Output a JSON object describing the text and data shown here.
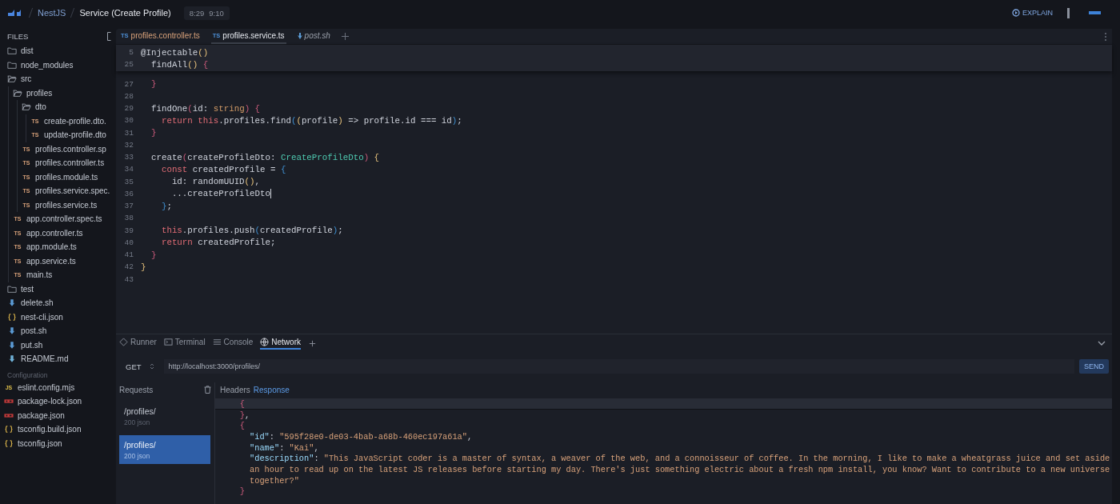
{
  "topbar": {
    "crumbs": [
      "NestJS",
      "Service (Create Profile)"
    ],
    "time": [
      "8:29",
      "9:10"
    ],
    "explain": "EXPLAIN"
  },
  "sidebar": {
    "title": "FILES",
    "files": [
      {
        "name": "dist",
        "kind": "folder",
        "expanded": false
      },
      {
        "name": "node_modules",
        "kind": "folder",
        "expanded": false
      },
      {
        "name": "src",
        "kind": "folder",
        "expanded": true,
        "children": [
          {
            "name": "profiles",
            "kind": "folder",
            "expanded": true,
            "children": [
              {
                "name": "dto",
                "kind": "folder",
                "expanded": true,
                "children": [
                  {
                    "name": "create-profile.dto.",
                    "kind": "ts",
                    "badge": "TS"
                  },
                  {
                    "name": "update-profile.dto",
                    "kind": "ts",
                    "badge": "TS"
                  }
                ]
              },
              {
                "name": "profiles.controller.sp",
                "kind": "ts",
                "badge": "TS"
              },
              {
                "name": "profiles.controller.ts",
                "kind": "ts",
                "badge": "TS"
              },
              {
                "name": "profiles.module.ts",
                "kind": "ts",
                "badge": "TS"
              },
              {
                "name": "profiles.service.spec.",
                "kind": "ts",
                "badge": "TS"
              },
              {
                "name": "profiles.service.ts",
                "kind": "ts",
                "badge": "TS"
              }
            ]
          },
          {
            "name": "app.controller.spec.ts",
            "kind": "ts",
            "badge": "TS"
          },
          {
            "name": "app.controller.ts",
            "kind": "ts",
            "badge": "TS"
          },
          {
            "name": "app.module.ts",
            "kind": "ts",
            "badge": "TS"
          },
          {
            "name": "app.service.ts",
            "kind": "ts",
            "badge": "TS"
          },
          {
            "name": "main.ts",
            "kind": "ts",
            "badge": "TS"
          }
        ]
      },
      {
        "name": "test",
        "kind": "folder",
        "expanded": false
      },
      {
        "name": "delete.sh",
        "kind": "sh"
      },
      {
        "name": "nest-cli.json",
        "kind": "json"
      },
      {
        "name": "post.sh",
        "kind": "sh"
      },
      {
        "name": "put.sh",
        "kind": "sh"
      },
      {
        "name": "README.md",
        "kind": "md"
      }
    ],
    "config_title": "Configuration",
    "config": [
      {
        "name": "eslint.config.mjs",
        "kind": "js",
        "badge": "JS"
      },
      {
        "name": "package-lock.json",
        "kind": "npm"
      },
      {
        "name": "package.json",
        "kind": "npm"
      },
      {
        "name": "tsconfig.build.json",
        "kind": "json"
      },
      {
        "name": "tsconfig.json",
        "kind": "json"
      }
    ]
  },
  "editor": {
    "tabs": [
      {
        "label": "profiles.controller.ts",
        "kind": "ts",
        "badge": "TS",
        "selected": false
      },
      {
        "label": "profiles.service.ts",
        "kind": "ts",
        "badge": "TS",
        "selected": true
      },
      {
        "label": "post.sh",
        "kind": "sh",
        "selected": false
      }
    ],
    "sticky": [
      {
        "number": "5",
        "tokens": [
          {
            "text": "@Injectable",
            "kind": "plain"
          },
          {
            "text": "()",
            "kind": "paren"
          }
        ]
      },
      {
        "number": "25",
        "tokens": [
          {
            "text": "  findAll",
            "kind": "plain"
          },
          {
            "text": "()",
            "kind": "paren"
          },
          {
            "text": " {",
            "kind": "brace"
          }
        ]
      }
    ],
    "lines": [
      {
        "number": "27",
        "cursor": false,
        "tokens": [
          {
            "text": "  }",
            "kind": "brace"
          }
        ]
      },
      {
        "number": "28",
        "cursor": false
      },
      {
        "number": "29",
        "cursor": false,
        "tokens": [
          {
            "text": "  findOne",
            "kind": "plain"
          },
          {
            "text": "(",
            "kind": "brace"
          },
          {
            "text": "id: ",
            "kind": "plain"
          },
          {
            "text": "string",
            "kind": "builtin"
          },
          {
            "text": ") {",
            "kind": "brace"
          }
        ]
      },
      {
        "number": "30",
        "cursor": false,
        "tokens": [
          {
            "text": "    return",
            "kind": "keyword"
          },
          {
            "text": " this",
            "kind": "keyword"
          },
          {
            "text": ".profiles.find",
            "kind": "plain"
          },
          {
            "text": "(",
            "kind": "block"
          },
          {
            "text": "(",
            "kind": "paren"
          },
          {
            "text": "profile",
            "kind": "plain"
          },
          {
            "text": ")",
            "kind": "paren"
          },
          {
            "text": " => profile.id === id",
            "kind": "plain"
          },
          {
            "text": ")",
            "kind": "block"
          },
          {
            "text": ";",
            "kind": "plain"
          }
        ]
      },
      {
        "number": "31",
        "cursor": false,
        "tokens": [
          {
            "text": "  }",
            "kind": "brace"
          }
        ]
      },
      {
        "number": "32",
        "cursor": false
      },
      {
        "number": "33",
        "cursor": false,
        "tokens": [
          {
            "text": "  create",
            "kind": "plain"
          },
          {
            "text": "(",
            "kind": "brace"
          },
          {
            "text": "createProfileDto: ",
            "kind": "plain"
          },
          {
            "text": "CreateProfileDto",
            "kind": "type"
          },
          {
            "text": ")",
            "kind": "brace"
          },
          {
            "text": " {",
            "kind": "paren"
          }
        ]
      },
      {
        "number": "34",
        "cursor": false,
        "tokens": [
          {
            "text": "    const",
            "kind": "keyword"
          },
          {
            "text": " createdProfile = ",
            "kind": "plain"
          },
          {
            "text": "{",
            "kind": "block"
          }
        ]
      },
      {
        "number": "35",
        "cursor": false,
        "tokens": [
          {
            "text": "      id: randomUUID",
            "kind": "plain"
          },
          {
            "text": "()",
            "kind": "paren"
          },
          {
            "text": ",",
            "kind": "plain"
          }
        ]
      },
      {
        "number": "36",
        "cursor": true,
        "tokens": [
          {
            "text": "      ...createProfileDto",
            "kind": "plain"
          }
        ]
      },
      {
        "number": "37",
        "cursor": false,
        "tokens": [
          {
            "text": "    }",
            "kind": "block"
          },
          {
            "text": ";",
            "kind": "plain"
          }
        ]
      },
      {
        "number": "38",
        "cursor": false
      },
      {
        "number": "39",
        "cursor": false,
        "tokens": [
          {
            "text": "    this",
            "kind": "keyword"
          },
          {
            "text": ".profiles.push",
            "kind": "plain"
          },
          {
            "text": "(",
            "kind": "block"
          },
          {
            "text": "createdProfile",
            "kind": "plain"
          },
          {
            "text": ")",
            "kind": "block"
          },
          {
            "text": ";",
            "kind": "plain"
          }
        ]
      },
      {
        "number": "40",
        "cursor": false,
        "tokens": [
          {
            "text": "    return",
            "kind": "keyword"
          },
          {
            "text": " createdProfile;",
            "kind": "plain"
          }
        ]
      },
      {
        "number": "41",
        "cursor": false,
        "tokens": [
          {
            "text": "  }",
            "kind": "brace"
          }
        ]
      },
      {
        "number": "42",
        "cursor": false,
        "tokens": [
          {
            "text": "}",
            "kind": "paren"
          }
        ]
      },
      {
        "number": "43",
        "cursor": false
      }
    ]
  },
  "panel": {
    "tabs": [
      {
        "label": "Runner",
        "kind": "runner",
        "selected": false
      },
      {
        "label": "Terminal",
        "kind": "terminal",
        "selected": false
      },
      {
        "label": "Console",
        "kind": "console",
        "selected": false
      },
      {
        "label": "Network",
        "kind": "network",
        "selected": true
      }
    ],
    "method": "GET",
    "url": "http://localhost:3000/profiles/",
    "send": "SEND",
    "requests_title": "Requests",
    "requests": [
      {
        "path": "/profiles/",
        "meta": "200 json",
        "selected": false
      },
      {
        "path": "/profiles/",
        "meta": "200 json",
        "selected": true
      }
    ],
    "response_tabs": [
      {
        "label": "Headers",
        "selected": false
      },
      {
        "label": "Response",
        "selected": true
      }
    ],
    "response": [
      {
        "current": true,
        "tokens": [
          {
            "text": "    {",
            "kind": "brace"
          }
        ]
      },
      {
        "current": false,
        "tokens": [
          {
            "text": "    }",
            "kind": "brace"
          },
          {
            "text": ",",
            "kind": "plain"
          }
        ]
      },
      {
        "current": false,
        "tokens": [
          {
            "text": "    {",
            "kind": "brace"
          }
        ]
      },
      {
        "current": false,
        "tokens": [
          {
            "text": "      \"id\"",
            "kind": "key"
          },
          {
            "text": ": ",
            "kind": "plain"
          },
          {
            "text": "\"595f28e0-de03-4bab-a68b-460ec197a61a\"",
            "kind": "string"
          },
          {
            "text": ",",
            "kind": "plain"
          }
        ]
      },
      {
        "current": false,
        "tokens": [
          {
            "text": "      \"name\"",
            "kind": "key"
          },
          {
            "text": ": ",
            "kind": "plain"
          },
          {
            "text": "\"Kai\"",
            "kind": "string"
          },
          {
            "text": ",",
            "kind": "plain"
          }
        ]
      },
      {
        "current": false,
        "tokens": [
          {
            "text": "      \"description\"",
            "kind": "key"
          },
          {
            "text": ": ",
            "kind": "plain"
          },
          {
            "text": "\"This JavaScript coder is a master of syntax, a weaver of the web, and a connoisseur of coffee. In the morning, I like to make a wheatgrass juice and set aside",
            "kind": "string"
          }
        ]
      },
      {
        "current": false,
        "tokens": [
          {
            "text": "      an hour to read up on the latest JS releases before starting my day. There's just something electric about a fresh npm install, you know? Want to contribute to a new universe",
            "kind": "string"
          }
        ]
      },
      {
        "current": false,
        "tokens": [
          {
            "text": "      together?\"",
            "kind": "string"
          }
        ]
      },
      {
        "current": false,
        "tokens": [
          {
            "text": "    }",
            "kind": "brace"
          }
        ]
      }
    ]
  }
}
